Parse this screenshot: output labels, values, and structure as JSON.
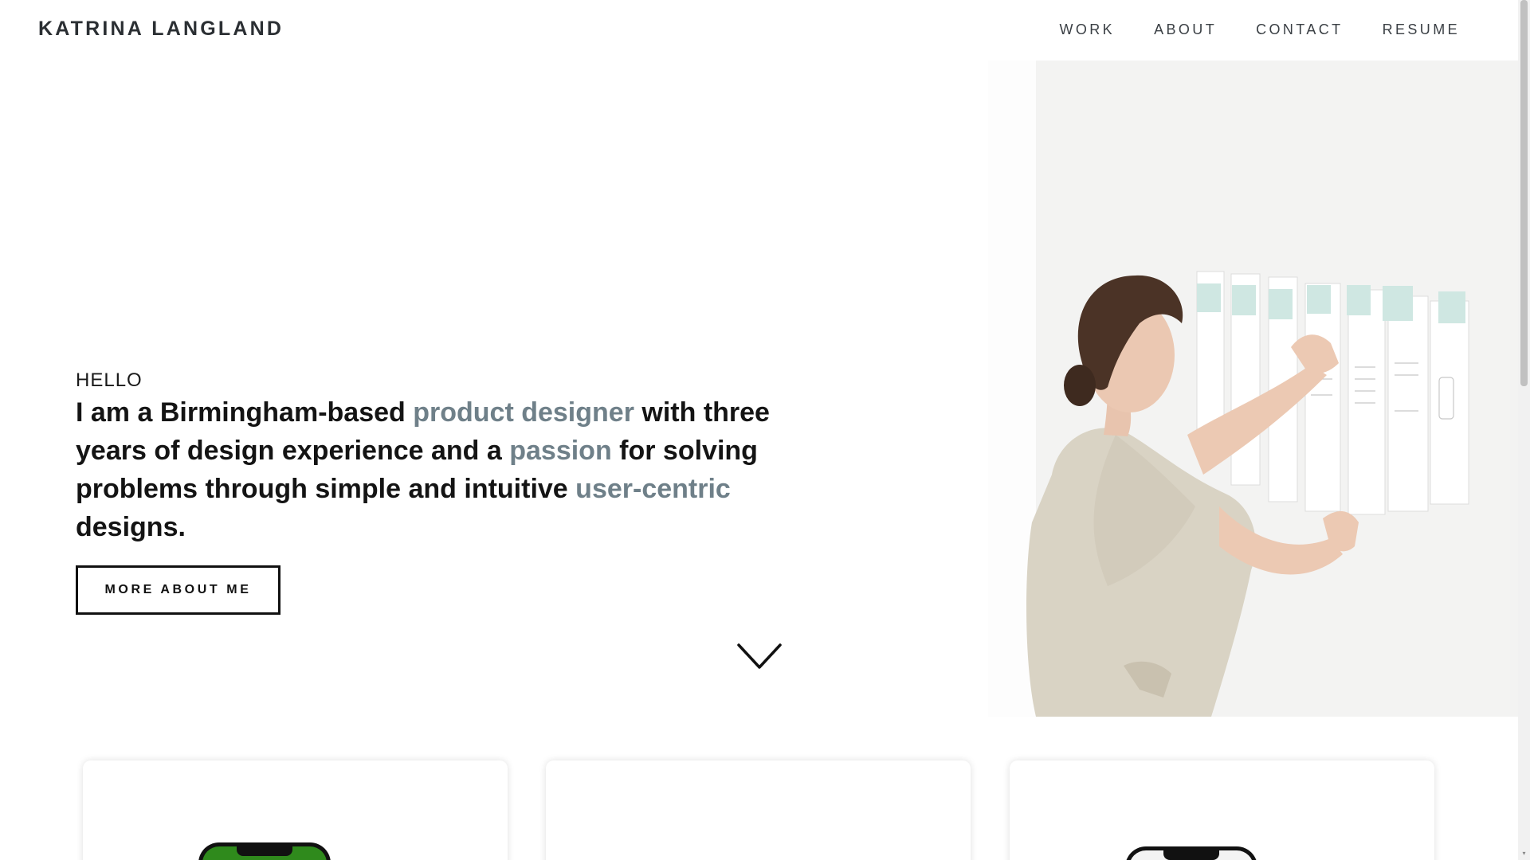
{
  "header": {
    "logo": "KATRINA LANGLAND",
    "nav": [
      {
        "label": "WORK"
      },
      {
        "label": "ABOUT"
      },
      {
        "label": "CONTACT"
      },
      {
        "label": "RESUME"
      }
    ]
  },
  "hero": {
    "greeting": "HELLO",
    "headline": {
      "part1": "I am a Birmingham-based ",
      "highlight1": "product designer",
      "part2": " with three years of design experience and a ",
      "highlight2": "passion",
      "part3": " for solving problems through simple and intuitive ",
      "highlight3": "user-centric",
      "part4": " designs."
    },
    "cta_label": "MORE ABOUT ME",
    "scroll_icon": "chevron-down-icon"
  },
  "colors": {
    "accent": "#6f8089",
    "text": "#141414"
  },
  "cards": [
    {
      "icon": "phone-mockup-green"
    },
    {
      "icon": ""
    },
    {
      "icon": "phone-mockup-light"
    }
  ]
}
